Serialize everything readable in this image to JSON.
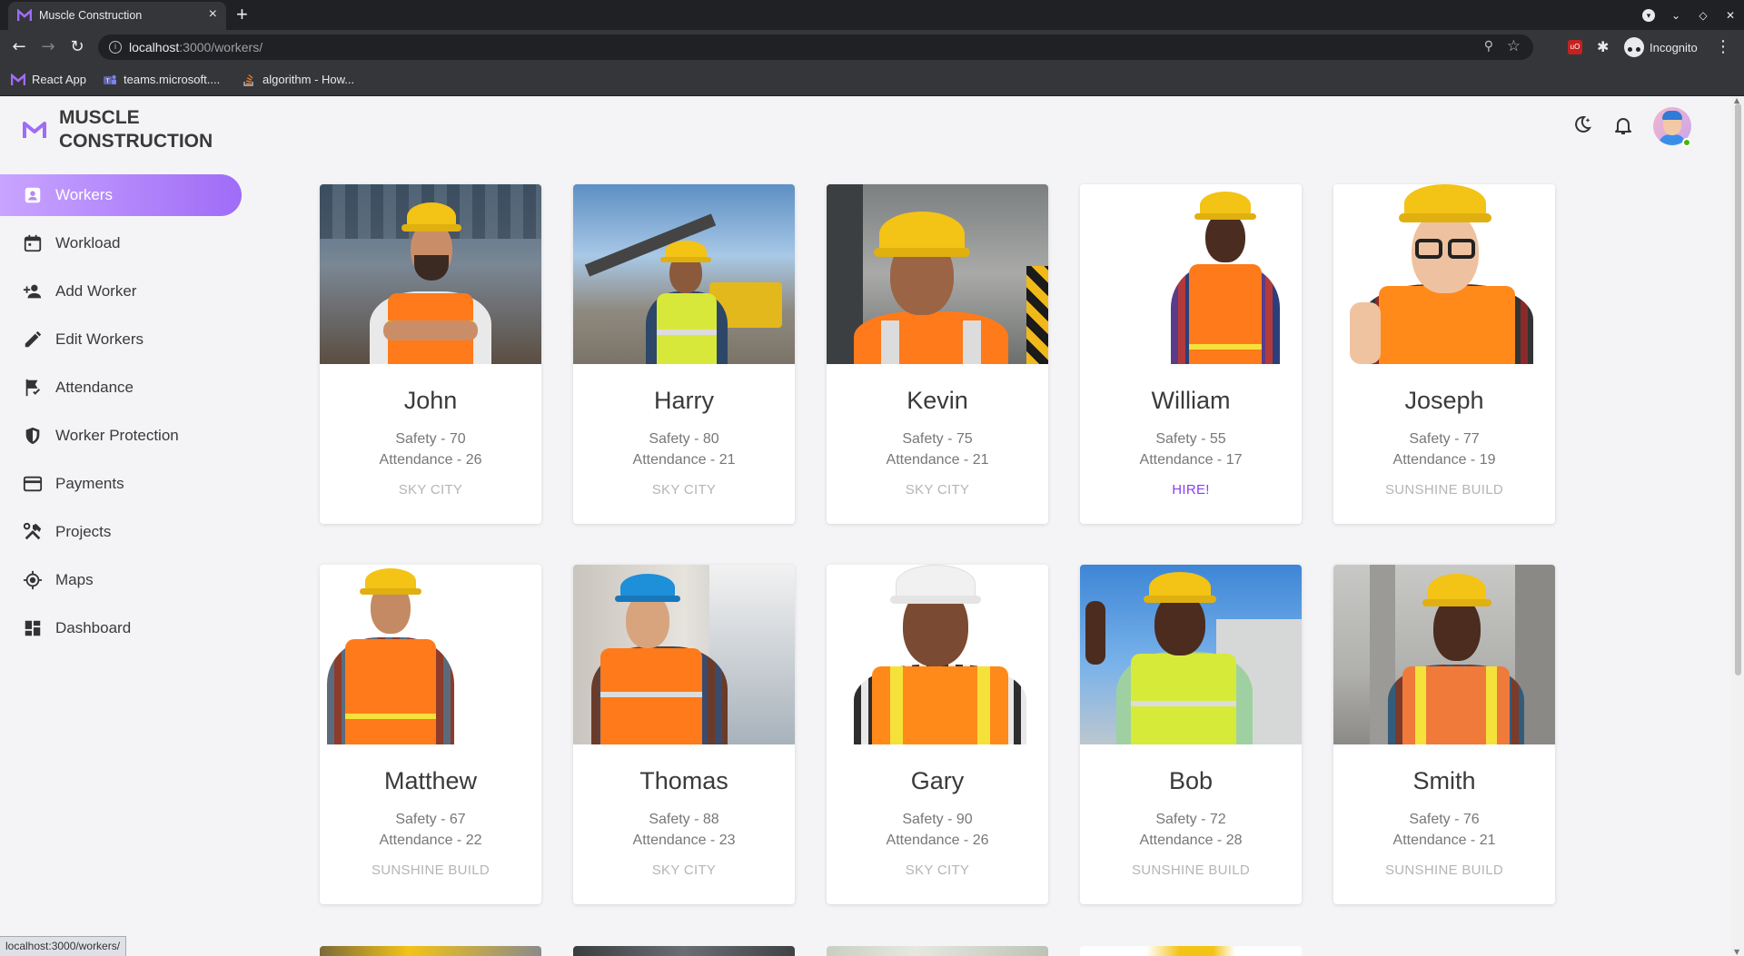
{
  "browser": {
    "tab_title": "Muscle Construction",
    "tab_close": "×",
    "new_tab": "+",
    "url_host": "localhost",
    "url_path": ":3000/workers/",
    "incognito_label": "Incognito",
    "extension_badge": "uO",
    "bookmarks": [
      {
        "label": "React App",
        "icon": "gmail-m-icon"
      },
      {
        "label": "teams.microsoft....",
        "icon": "teams-icon"
      },
      {
        "label": "algorithm - How...",
        "icon": "stackoverflow-icon"
      }
    ],
    "status_link": "localhost:3000/workers/"
  },
  "app": {
    "brand_line1": "MUSCLE",
    "brand_line2": "CONSTRUCTION",
    "accent": "#9f6cf7"
  },
  "sidebar": {
    "items": [
      {
        "label": "Workers",
        "icon": "worker-badge-icon",
        "active": true
      },
      {
        "label": "Workload",
        "icon": "calendar-icon",
        "active": false
      },
      {
        "label": "Add Worker",
        "icon": "person-add-icon",
        "active": false
      },
      {
        "label": "Edit Workers",
        "icon": "pencil-icon",
        "active": false
      },
      {
        "label": "Attendance",
        "icon": "flag-check-icon",
        "active": false
      },
      {
        "label": "Worker Protection",
        "icon": "shield-icon",
        "active": false
      },
      {
        "label": "Payments",
        "icon": "credit-card-icon",
        "active": false
      },
      {
        "label": "Projects",
        "icon": "tools-icon",
        "active": false
      },
      {
        "label": "Maps",
        "icon": "location-target-icon",
        "active": false
      },
      {
        "label": "Dashboard",
        "icon": "dashboard-icon",
        "active": false
      }
    ]
  },
  "workers": [
    {
      "name": "John",
      "safety": "Safety - 70",
      "attendance": "Attendance - 26",
      "site": "SKY CITY",
      "hire": false
    },
    {
      "name": "Harry",
      "safety": "Safety - 80",
      "attendance": "Attendance - 21",
      "site": "SKY CITY",
      "hire": false
    },
    {
      "name": "Kevin",
      "safety": "Safety - 75",
      "attendance": "Attendance - 21",
      "site": "SKY CITY",
      "hire": false
    },
    {
      "name": "William",
      "safety": "Safety - 55",
      "attendance": "Attendance - 17",
      "site": "HIRE!",
      "hire": true
    },
    {
      "name": "Joseph",
      "safety": "Safety - 77",
      "attendance": "Attendance - 19",
      "site": "SUNSHINE BUILD",
      "hire": false
    },
    {
      "name": "Matthew",
      "safety": "Safety - 67",
      "attendance": "Attendance - 22",
      "site": "SUNSHINE BUILD",
      "hire": false
    },
    {
      "name": "Thomas",
      "safety": "Safety - 88",
      "attendance": "Attendance - 23",
      "site": "SKY CITY",
      "hire": false
    },
    {
      "name": "Gary",
      "safety": "Safety - 90",
      "attendance": "Attendance - 26",
      "site": "SKY CITY",
      "hire": false
    },
    {
      "name": "Bob",
      "safety": "Safety - 72",
      "attendance": "Attendance - 28",
      "site": "SUNSHINE BUILD",
      "hire": false
    },
    {
      "name": "Smith",
      "safety": "Safety - 76",
      "attendance": "Attendance - 21",
      "site": "SUNSHINE BUILD",
      "hire": false
    }
  ]
}
